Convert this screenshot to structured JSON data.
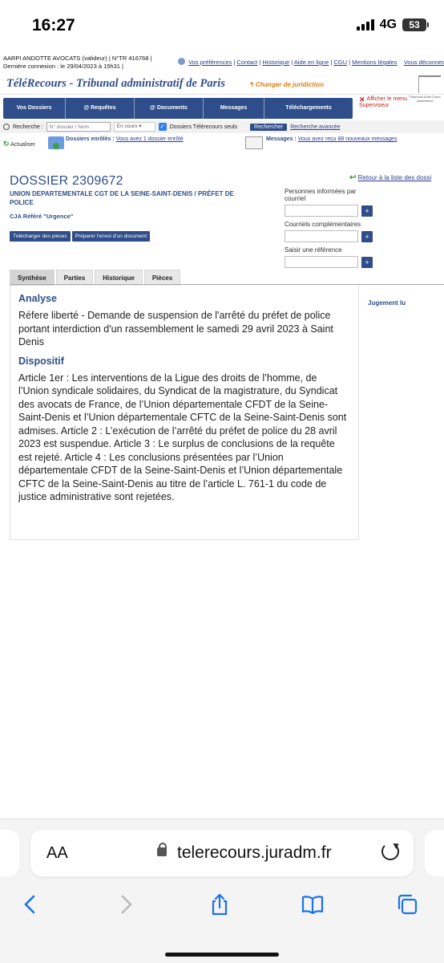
{
  "status": {
    "time": "16:27",
    "network": "4G",
    "battery": "53"
  },
  "topbar": {
    "user_info": "AARPI ANDOTTE AVOCATS (valideur) | N°TR 416768 | Dernière connexion : le 29/04/2023 à 15h31 |",
    "links": [
      "Vos préférences",
      "Contact",
      "Historique",
      "Aide en ligne",
      "CGU",
      "Mentions légales",
      "Vous déconnect"
    ]
  },
  "header": {
    "title": "TéléRecours - Tribunal administratif de Paris",
    "change": "Changer de juridiction",
    "logo_text": "Tribunaux Admi Cours Administrat"
  },
  "nav": {
    "items": [
      "Vos Dossiers",
      "@ Requêtes",
      "@ Documents",
      "Messages",
      "Téléchargements"
    ],
    "superviseur": "Afficher le menu Superviseur"
  },
  "search": {
    "label": "Recherche :",
    "placeholder": "N° dossier / Nom",
    "status_select": "En cours",
    "checkbox_label": "Dossiers Télérecours seuls",
    "button": "Rechercher",
    "advanced": "Recherche avancée"
  },
  "notif": {
    "refresh": "Actualiser",
    "enrol_label": "Dossiers enrôlés :",
    "enrol_link": "Vous avez 1 dossier enrôlé",
    "msg_label": "Messages :",
    "msg_link": "Vous avez reçu 88 nouveaux messages"
  },
  "dossier": {
    "return": "Retour à la liste des dossi",
    "title": "DOSSIER 2309672",
    "parties": "UNION DEPARTEMENTALE CGT DE LA SEINE-SAINT-DENIS / PRÉFET DE POLICE",
    "cja": "CJA Référé \"Urgence\"",
    "btn_download": "Télécharger des pièces",
    "btn_prepare": "Préparer l'envoi d'un document"
  },
  "side_form": {
    "persons": "Personnes informées par courriel",
    "courriels": "Courriels complémentaires",
    "reference": "Saisir une référence",
    "plus": "+"
  },
  "tabs": [
    "Synthèse",
    "Parties",
    "Historique",
    "Pièces"
  ],
  "synthese": {
    "analyse_title": "Analyse",
    "analyse_text": "Réfere liberté - Demande de suspension de l'arrêté du préfet de police portant interdiction d'un rassemblement le samedi 29 avril 2023 à Saint Denis",
    "dispositif_title": "Dispositif",
    "dispositif_text": "Article 1er : Les interventions de la Ligue des droits de l’homme, de l’Union syndicale solidaires, du Syndicat de la magistrature, du Syndicat des avocats de France, de l’Union départementale CFDT de la Seine-Saint-Denis et l’Union départementale CFTC de la Seine-Saint-Denis sont admises. Article 2 : L’exécution de l’arrêté du préfet de police du 28 avril 2023 est suspendue. Article 3 : Le surplus de conclusions de la requête est rejeté. Article 4 : Les conclusions présentées par l’Union départementale CFDT de la Seine-Saint-Denis et l’Union départementale CFTC de la Seine-Saint-Denis au titre de l’article L. 761-1 du code de justice administrative sont rejetées.",
    "jugement": "Jugement lu"
  },
  "safari": {
    "aa": "AA",
    "url": "telerecours.juradm.fr"
  }
}
